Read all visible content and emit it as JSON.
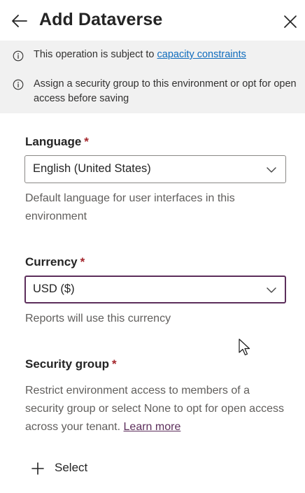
{
  "header": {
    "title": "Add Dataverse"
  },
  "info": [
    {
      "text": "This operation is subject to ",
      "link": "capacity constraints"
    },
    {
      "text": "Assign a security group to this environment or opt for open access before saving"
    }
  ],
  "language": {
    "label": "Language",
    "required_mark": "*",
    "value": "English (United States)",
    "help": "Default language for user interfaces in this environment"
  },
  "currency": {
    "label": "Currency",
    "required_mark": "*",
    "value": "USD ($)",
    "help": "Reports will use this currency"
  },
  "security_group": {
    "label": "Security group",
    "required_mark": "*",
    "help": "Restrict environment access to members of a security group or select None to opt for open access across your tenant.",
    "learn_more": "Learn more",
    "select_label": "Select"
  },
  "colors": {
    "focus_border": "#5c2e5b",
    "link": "#0f6cbd",
    "required": "#a4262c",
    "info_background": "#f1f1f1"
  },
  "icons": {
    "back": "arrow-left-icon",
    "close": "close-icon",
    "info": "info-icon",
    "dropdown": "chevron-down-icon",
    "add": "plus-icon",
    "pointer": "mouse-cursor-icon"
  }
}
